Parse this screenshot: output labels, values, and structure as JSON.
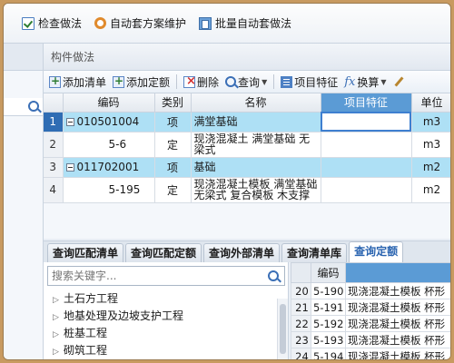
{
  "top_toolbar": {
    "check": "检查做法",
    "auto_maintain": "自动套方案维护",
    "batch_auto": "批量自动套做法"
  },
  "panel": {
    "title": "构件做法",
    "toolbar": {
      "add_list": "添加清单",
      "add_quota": "添加定额",
      "delete": "删除",
      "query": "查询",
      "item_feature": "项目特征",
      "convert": "换算"
    },
    "columns": [
      "编码",
      "类别",
      "名称",
      "项目特征",
      "单位"
    ],
    "rows": [
      {
        "num": "1",
        "code": "010501004",
        "type": "项",
        "name": "满堂基础",
        "feature": "",
        "unit": "m3"
      },
      {
        "num": "2",
        "code": "5-6",
        "type": "定",
        "name": "现浇混凝土 满堂基础 无梁式",
        "feature": "",
        "unit": "m3"
      },
      {
        "num": "3",
        "code": "011702001",
        "type": "项",
        "name": "基础",
        "feature": "",
        "unit": "m2"
      },
      {
        "num": "4",
        "code": "5-195",
        "type": "定",
        "name": "现浇混凝土模板 满堂基础 无梁式 复合模板 木支撑",
        "feature": "",
        "unit": "m2"
      }
    ]
  },
  "bottom": {
    "tabs": [
      "查询匹配清单",
      "查询匹配定额",
      "查询外部清单",
      "查询清单库",
      "查询定额"
    ],
    "search_placeholder": "搜索关键字...",
    "tree": [
      "土石方工程",
      "地基处理及边坡支护工程",
      "桩基工程",
      "砌筑工程"
    ],
    "sub_table": {
      "header": "编码",
      "rows": [
        {
          "num": "20",
          "code": "5-190",
          "name": "现浇混凝土模板 杯形"
        },
        {
          "num": "21",
          "code": "5-191",
          "name": "现浇混凝土模板 杯形"
        },
        {
          "num": "22",
          "code": "5-192",
          "name": "现浇混凝土模板 杯形"
        },
        {
          "num": "23",
          "code": "5-193",
          "name": "现浇混凝土模板 杯形"
        },
        {
          "num": "24",
          "code": "5-194",
          "name": "现浇混凝土模板 杯形"
        }
      ]
    }
  }
}
